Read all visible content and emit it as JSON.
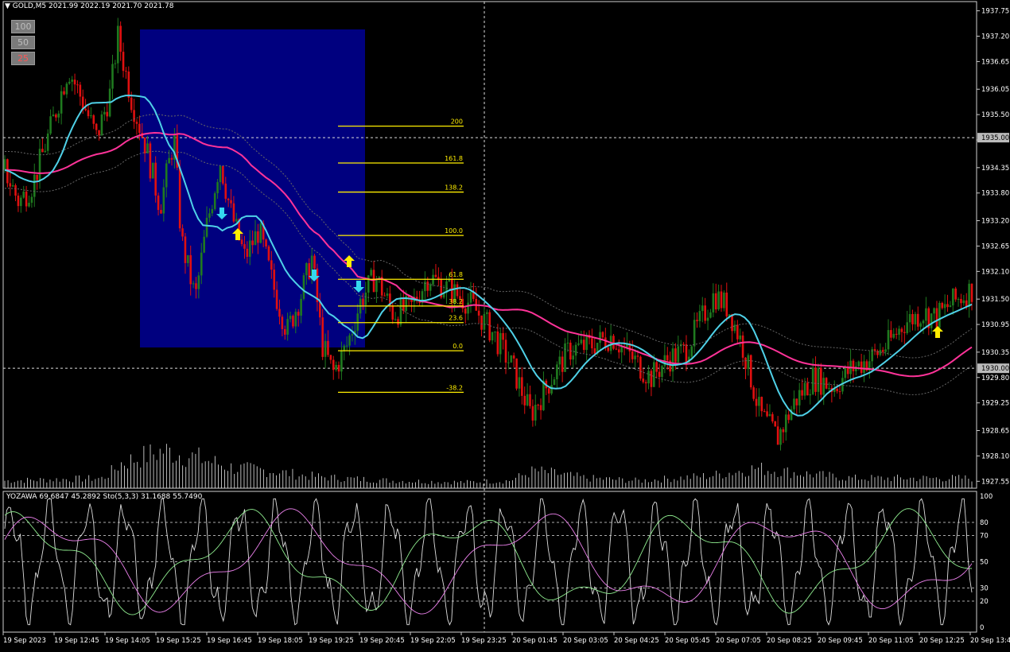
{
  "header": {
    "symbol": "GOLD,M5",
    "ohlc": "2021.99 2022.19 2021.70 2021.78",
    "zoom_buttons": [
      "100",
      "50",
      "25"
    ]
  },
  "oscillator": {
    "label": "YOZAWA 69.6847 45.2892  Sto(5,3,3) 31.1688 55.7490",
    "levels": [
      100,
      80,
      70,
      50,
      30,
      20,
      0
    ]
  },
  "colors": {
    "background": "#000000",
    "bull_candle": "#1f7a1f",
    "bear_candle": "#e01010",
    "ma_fast": "#4fd1e8",
    "ma_slow": "#3a7fe0",
    "ma_long": "#ff3399",
    "fib_line": "#ffee00",
    "highlight_box": "#00007f",
    "arrow_up": "#ffee00",
    "arrow_down": "#35d8ee"
  },
  "chart_data": {
    "type": "candlestick",
    "price_axis": {
      "ticks": [
        "1937.75",
        "1937.20",
        "1936.65",
        "1936.05",
        "1935.50",
        "1934.95",
        "1934.35",
        "1933.80",
        "1933.20",
        "1932.65",
        "1932.10",
        "1931.50",
        "1930.95",
        "1930.35",
        "1929.80",
        "1929.25",
        "1928.65",
        "1928.10",
        "1927.55"
      ],
      "range": [
        1927.4,
        1937.95
      ],
      "marked_levels": [
        "1935.00",
        "1930.00"
      ]
    },
    "time_axis": {
      "labels": [
        "19 Sep 2023",
        "19 Sep 12:45",
        "19 Sep 14:05",
        "19 Sep 15:25",
        "19 Sep 16:45",
        "19 Sep 18:05",
        "19 Sep 19:25",
        "19 Sep 20:45",
        "19 Sep 22:05",
        "19 Sep 23:25",
        "20 Sep 01:45",
        "20 Sep 03:05",
        "20 Sep 04:25",
        "20 Sep 05:45",
        "20 Sep 07:05",
        "20 Sep 08:25",
        "20 Sep 09:45",
        "20 Sep 11:05",
        "20 Sep 12:25",
        "20 Sep 13:4"
      ]
    },
    "fibonacci": {
      "levels": [
        "200",
        "161.8",
        "138.2",
        "100.0",
        "61.8",
        "38.2",
        "23.6",
        "0.0",
        "-38.2"
      ]
    },
    "close_path": [
      {
        "t": 0,
        "p": 1934.3
      },
      {
        "t": 0.4,
        "p": 1933.6
      },
      {
        "t": 0.8,
        "p": 1934.0
      },
      {
        "t": 1.3,
        "p": 1935.2
      },
      {
        "t": 1.8,
        "p": 1936.5
      },
      {
        "t": 2.2,
        "p": 1935.8
      },
      {
        "t": 2.6,
        "p": 1935.0
      },
      {
        "t": 3.0,
        "p": 1936.0
      },
      {
        "t": 3.2,
        "p": 1937.2
      },
      {
        "t": 3.6,
        "p": 1935.8
      },
      {
        "t": 4.0,
        "p": 1934.8
      },
      {
        "t": 4.4,
        "p": 1933.5
      },
      {
        "t": 4.8,
        "p": 1935.0
      },
      {
        "t": 5.0,
        "p": 1932.8
      },
      {
        "t": 5.4,
        "p": 1931.5
      },
      {
        "t": 5.7,
        "p": 1933.0
      },
      {
        "t": 6.1,
        "p": 1934.5
      },
      {
        "t": 6.4,
        "p": 1933.4
      },
      {
        "t": 6.8,
        "p": 1932.4
      },
      {
        "t": 7.2,
        "p": 1933.0
      },
      {
        "t": 7.6,
        "p": 1931.8
      },
      {
        "t": 8.0,
        "p": 1930.8
      },
      {
        "t": 8.4,
        "p": 1931.6
      },
      {
        "t": 8.7,
        "p": 1932.4
      },
      {
        "t": 9.0,
        "p": 1930.5
      },
      {
        "t": 9.3,
        "p": 1929.9
      },
      {
        "t": 9.7,
        "p": 1930.5
      },
      {
        "t": 10.1,
        "p": 1931.5
      },
      {
        "t": 10.5,
        "p": 1932.0
      },
      {
        "t": 11.0,
        "p": 1931.2
      },
      {
        "t": 11.5,
        "p": 1931.3
      },
      {
        "t": 12.0,
        "p": 1932.0
      },
      {
        "t": 12.6,
        "p": 1931.7
      },
      {
        "t": 13.2,
        "p": 1931.4
      },
      {
        "t": 13.8,
        "p": 1930.8
      },
      {
        "t": 14.4,
        "p": 1930.0
      },
      {
        "t": 14.9,
        "p": 1929.0
      },
      {
        "t": 15.5,
        "p": 1929.8
      },
      {
        "t": 16.0,
        "p": 1930.4
      },
      {
        "t": 16.6,
        "p": 1930.5
      },
      {
        "t": 17.2,
        "p": 1930.7
      },
      {
        "t": 17.8,
        "p": 1930.2
      },
      {
        "t": 18.3,
        "p": 1929.8
      },
      {
        "t": 18.8,
        "p": 1930.2
      },
      {
        "t": 19.3,
        "p": 1930.4
      },
      {
        "t": 19.7,
        "p": 1931.0
      },
      {
        "t": 20.1,
        "p": 1931.6
      },
      {
        "t": 20.5,
        "p": 1931.3
      },
      {
        "t": 20.9,
        "p": 1930.5
      },
      {
        "t": 21.4,
        "p": 1929.0
      },
      {
        "t": 21.9,
        "p": 1928.5
      },
      {
        "t": 22.4,
        "p": 1929.3
      },
      {
        "t": 22.9,
        "p": 1929.8
      },
      {
        "t": 23.5,
        "p": 1929.6
      },
      {
        "t": 24.0,
        "p": 1930.0
      },
      {
        "t": 24.5,
        "p": 1930.2
      },
      {
        "t": 25.0,
        "p": 1930.5
      },
      {
        "t": 25.5,
        "p": 1931.0
      },
      {
        "t": 26.0,
        "p": 1931.2
      },
      {
        "t": 26.4,
        "p": 1931.1
      },
      {
        "t": 26.8,
        "p": 1931.4
      },
      {
        "t": 27.4,
        "p": 1931.7
      }
    ],
    "volume_profile": [
      {
        "t": 0,
        "v": 0.15
      },
      {
        "t": 2.8,
        "v": 0.2
      },
      {
        "t": 3.3,
        "v": 0.5
      },
      {
        "t": 4.5,
        "v": 0.75
      },
      {
        "t": 5.5,
        "v": 0.6
      },
      {
        "t": 6.5,
        "v": 0.4
      },
      {
        "t": 7.5,
        "v": 0.35
      },
      {
        "t": 8.5,
        "v": 0.25
      },
      {
        "t": 9.5,
        "v": 0.2
      },
      {
        "t": 11,
        "v": 0.15
      },
      {
        "t": 13,
        "v": 0.12
      },
      {
        "t": 14.3,
        "v": 0.15
      },
      {
        "t": 15.0,
        "v": 0.35
      },
      {
        "t": 16.5,
        "v": 0.2
      },
      {
        "t": 18,
        "v": 0.15
      },
      {
        "t": 20,
        "v": 0.25
      },
      {
        "t": 21.3,
        "v": 0.4
      },
      {
        "t": 22.5,
        "v": 0.3
      },
      {
        "t": 24,
        "v": 0.2
      },
      {
        "t": 26,
        "v": 0.2
      },
      {
        "t": 27.4,
        "v": 0.2
      }
    ]
  }
}
